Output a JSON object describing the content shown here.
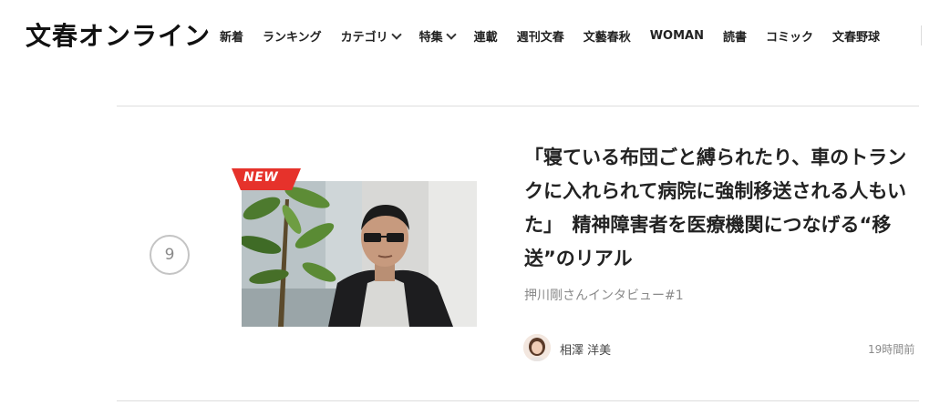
{
  "site": {
    "logo": "文春オンライン"
  },
  "nav": {
    "items": [
      {
        "label": "新着",
        "has_dropdown": false
      },
      {
        "label": "ランキング",
        "has_dropdown": false
      },
      {
        "label": "カテゴリ",
        "has_dropdown": true
      },
      {
        "label": "特集",
        "has_dropdown": true
      },
      {
        "label": "連載",
        "has_dropdown": false
      },
      {
        "label": "週刊文春",
        "has_dropdown": false
      },
      {
        "label": "文藝春秋",
        "has_dropdown": false
      },
      {
        "label": "WOMAN",
        "has_dropdown": false
      },
      {
        "label": "読書",
        "has_dropdown": false
      },
      {
        "label": "コミック",
        "has_dropdown": false
      },
      {
        "label": "文春野球",
        "has_dropdown": false
      }
    ]
  },
  "article": {
    "rank": "9",
    "badge": "NEW",
    "title": "「寝ている布団ごと縛られたり、車のトランクに入れられて病院に強制移送される人もいた」　精神障害者を医療機関につなげる“移送”のリアル",
    "subtitle": "押川剛さんインタビュー#1",
    "author": "相澤 洋美",
    "time": "19時間前"
  },
  "colors": {
    "badge_red": "#e6322b",
    "text_main": "#222222",
    "text_muted": "#8a8a8a",
    "divider": "#dddddd"
  }
}
